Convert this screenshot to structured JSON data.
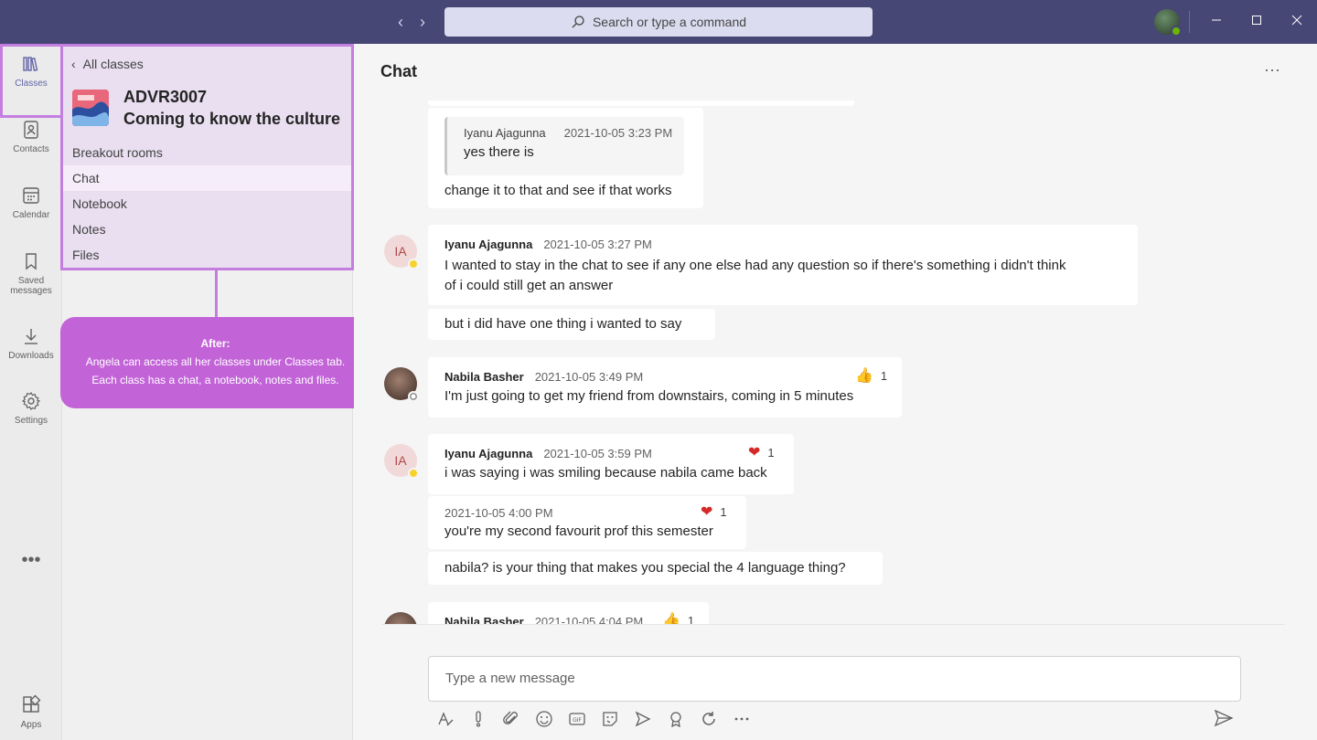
{
  "titlebar": {
    "search_placeholder": "Search or type a command"
  },
  "rail": {
    "items": [
      {
        "label": "Classes",
        "icon": "classes-icon"
      },
      {
        "label": "Contacts",
        "icon": "contacts-icon"
      },
      {
        "label": "Calendar",
        "icon": "calendar-icon"
      },
      {
        "label": "Saved messages",
        "icon": "bookmark-icon"
      },
      {
        "label": "Downloads",
        "icon": "download-icon"
      },
      {
        "label": "Settings",
        "icon": "gear-icon"
      },
      {
        "label": "Apps",
        "icon": "apps-icon"
      }
    ],
    "more": "•••"
  },
  "panel": {
    "back_label": "All classes",
    "class_code": "ADVR3007",
    "class_name": "Coming to know the culture",
    "nav": [
      "Breakout rooms",
      "Chat",
      "Notebook",
      "Notes",
      "Files"
    ],
    "active_nav": "Chat"
  },
  "callout": {
    "title": "After:",
    "line1": "Angela can access all her classes under Classes tab.",
    "line2": "Each class has a chat, a notebook, notes and files."
  },
  "chat": {
    "title": "Chat",
    "more": "···",
    "quote_author": "Iyanu Ajagunna",
    "quote_time": "2021-10-05 3:23 PM",
    "quote_text": "yes there is",
    "msg0_text": "change it to that and see if that works",
    "msg1": {
      "initials": "IA",
      "author": "Iyanu Ajagunna",
      "time": "2021-10-05 3:27 PM",
      "text_line1": "I wanted to stay in the chat to see if any one else had any question so if there's something i didn't think",
      "text_line2": "of i could still get an answer",
      "followup": "but i did have one thing i wanted to say"
    },
    "msg2": {
      "author": "Nabila Basher",
      "time": "2021-10-05 3:49 PM",
      "text": "I'm just going to get my friend from downstairs, coming in 5 minutes",
      "reaction_count": "1"
    },
    "msg3": {
      "initials": "IA",
      "author": "Iyanu Ajagunna",
      "time": "2021-10-05 3:59 PM",
      "text": "i was saying i was smiling because nabila came back",
      "reaction_count": "1"
    },
    "msg4": {
      "time": "2021-10-05 4:00 PM",
      "text": "you're my second favourit prof this semester",
      "reaction_count": "1"
    },
    "msg5_text": "nabila? is your thing that makes you special the 4 language thing?",
    "msg6": {
      "author": "Nabila Basher",
      "time": "2021-10-05 4:04 PM",
      "reaction_count": "1"
    },
    "compose_placeholder": "Type a new message"
  }
}
